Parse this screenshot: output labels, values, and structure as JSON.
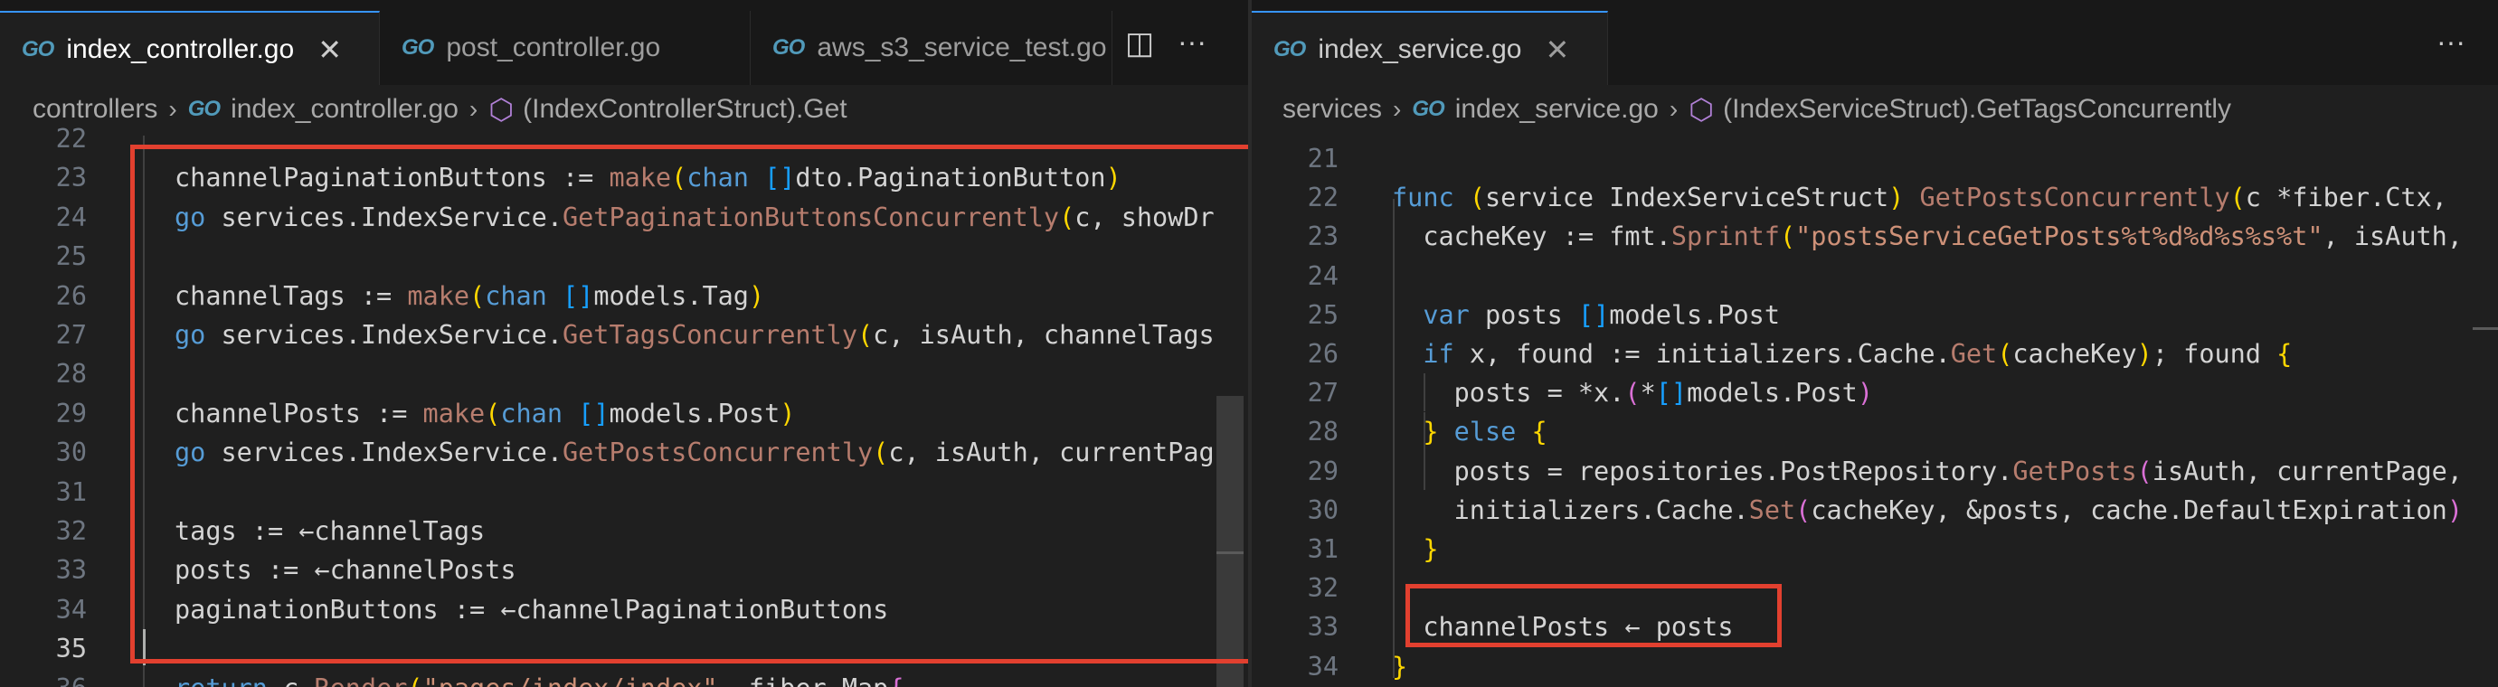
{
  "left": {
    "tabs": [
      {
        "label": "index_controller.go",
        "active": true
      },
      {
        "label": "post_controller.go",
        "active": false
      },
      {
        "label": "aws_s3_service_test.go",
        "active": false
      }
    ],
    "breadcrumb": {
      "folder": "controllers",
      "file": "index_controller.go",
      "symbol": "(IndexControllerStruct).Get"
    },
    "lines": [
      {
        "n": "22",
        "html": ""
      },
      {
        "n": "23",
        "html": "channelPaginationButtons := <span class='mfn'>make</span><span class='br1'>(</span><span class='kw'>chan</span> <span class='br3'>[]</span>dto.PaginationButton<span class='br1'>)</span>"
      },
      {
        "n": "24",
        "html": "<span class='kw'>go</span> services.IndexService.<span class='mfn'>GetPaginationButtonsConcurrently</span><span class='br1'>(</span>c, showDr"
      },
      {
        "n": "25",
        "html": ""
      },
      {
        "n": "26",
        "html": "channelTags := <span class='mfn'>make</span><span class='br1'>(</span><span class='kw'>chan</span> <span class='br3'>[]</span>models.Tag<span class='br1'>)</span>"
      },
      {
        "n": "27",
        "html": "<span class='kw'>go</span> services.IndexService.<span class='mfn'>GetTagsConcurrently</span><span class='br1'>(</span>c, isAuth, channelTags"
      },
      {
        "n": "28",
        "html": ""
      },
      {
        "n": "29",
        "html": "channelPosts := <span class='mfn'>make</span><span class='br1'>(</span><span class='kw'>chan</span> <span class='br3'>[]</span>models.Post<span class='br1'>)</span>"
      },
      {
        "n": "30",
        "html": "<span class='kw'>go</span> services.IndexService.<span class='mfn'>GetPostsConcurrently</span><span class='br1'>(</span>c, isAuth, currentPag"
      },
      {
        "n": "31",
        "html": ""
      },
      {
        "n": "32",
        "html": "tags := ←channelTags"
      },
      {
        "n": "33",
        "html": "posts := ←channelPosts"
      },
      {
        "n": "34",
        "html": "paginationButtons := ←channelPaginationButtons"
      },
      {
        "n": "35",
        "html": ""
      },
      {
        "n": "36",
        "html": "<span class='kw'>return</span> c.<span class='mfn'>Render</span><span class='br1'>(</span><span class='str'>\"pages/index/index\"</span>, fiber.Map<span class='br2'>{</span>"
      }
    ]
  },
  "right": {
    "tabs": [
      {
        "label": "index_service.go",
        "active": true
      }
    ],
    "breadcrumb": {
      "folder": "services",
      "file": "index_service.go",
      "symbol": "(IndexServiceStruct).GetTagsConcurrently"
    },
    "lines": [
      {
        "n": "21",
        "html": ""
      },
      {
        "n": "22",
        "html": "<span class='kw'>func</span> <span class='br1'>(</span>service IndexServiceStruct<span class='br1'>)</span> <span class='mfn'>GetPostsConcurrently</span><span class='br1'>(</span>c *fiber.Ctx,"
      },
      {
        "n": "23",
        "html": "  cacheKey := fmt.<span class='mfn'>Sprintf</span><span class='br1'>(</span><span class='str'>\"postsServiceGetPosts%t%d%d%s%s%t\"</span>, isAuth,"
      },
      {
        "n": "24",
        "html": ""
      },
      {
        "n": "25",
        "html": "  <span class='kw'>var</span> posts <span class='br3'>[]</span>models.Post"
      },
      {
        "n": "26",
        "html": "  <span class='kw'>if</span> x, found := initializers.Cache.<span class='mfn'>Get</span><span class='br1'>(</span>cacheKey<span class='br1'>)</span>; found <span class='br1'>{</span>"
      },
      {
        "n": "27",
        "html": "    posts = *x.<span class='br2'>(</span>*<span class='br3'>[]</span>models.Post<span class='br2'>)</span>"
      },
      {
        "n": "28",
        "html": "  <span class='br1'>}</span> <span class='kw'>else</span> <span class='br1'>{</span>"
      },
      {
        "n": "29",
        "html": "    posts = repositories.PostRepository.<span class='mfn'>GetPosts</span><span class='br2'>(</span>isAuth, currentPage,"
      },
      {
        "n": "30",
        "html": "    initializers.Cache.<span class='mfn'>Set</span><span class='br2'>(</span>cacheKey, &amp;posts, cache.DefaultExpiration<span class='br2'>)</span>"
      },
      {
        "n": "31",
        "html": "  <span class='br1'>}</span>"
      },
      {
        "n": "32",
        "html": ""
      },
      {
        "n": "33",
        "html": "  channelPosts ← posts"
      },
      {
        "n": "34",
        "html": "<span class='br1'>}</span>"
      }
    ]
  },
  "icons": {
    "go": "GO",
    "close": "✕",
    "split": "◫",
    "more": "···",
    "chevron": "›",
    "cube": "⬡"
  }
}
